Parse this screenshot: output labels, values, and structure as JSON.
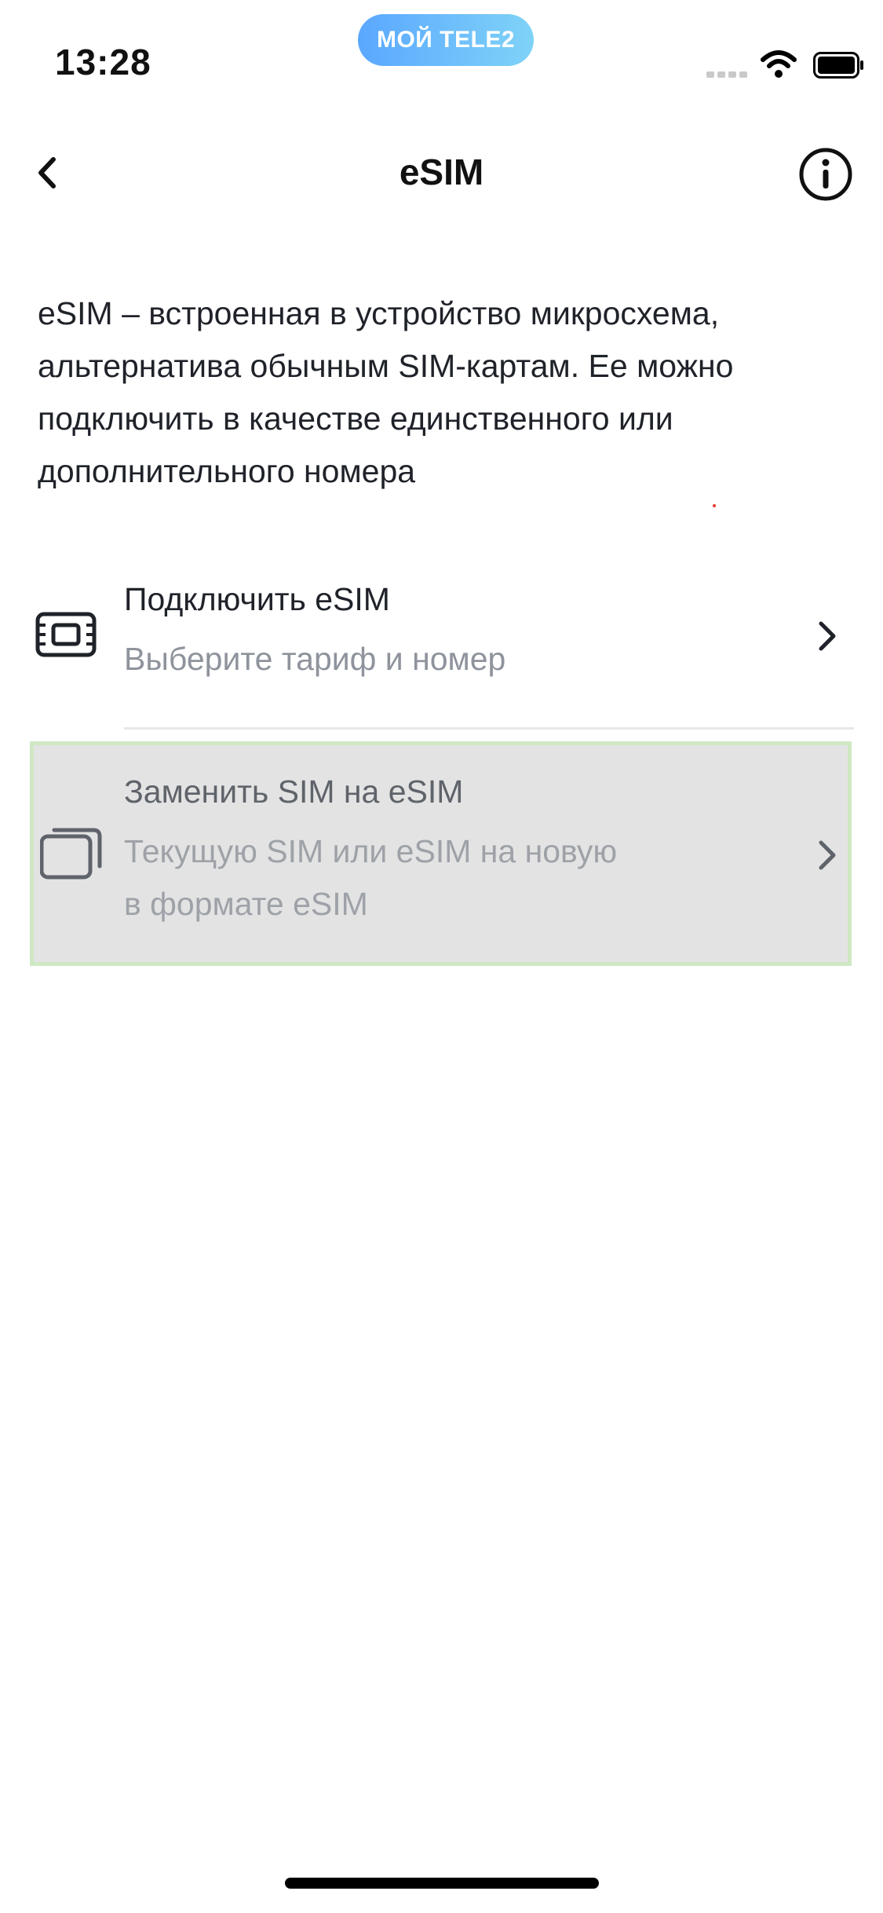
{
  "status_bar": {
    "time": "13:28",
    "app_badge": "МОЙ TELE2"
  },
  "nav": {
    "title": "eSIM"
  },
  "intro_text": "eSIM – встроенная в устройство микросхема, альтернатива обычным SIM-картам. Ее можно подключить в качестве единственного или дополнительного номера",
  "options": [
    {
      "title": "Подключить eSIM",
      "subtitle": "Выберите тариф и номер",
      "icon": "sim-card-icon"
    },
    {
      "title": "Заменить SIM на eSIM",
      "subtitle_line1": "Текущую SIM или eSIM на новую",
      "subtitle_line2": "в формате eSIM",
      "icon": "sim-swap-icon"
    }
  ],
  "colors": {
    "accent_gradient_start": "#5aa7ff",
    "accent_gradient_end": "#7fd3f7",
    "highlight_background": "#e3e3e3",
    "highlight_border": "#cfe8c4"
  }
}
